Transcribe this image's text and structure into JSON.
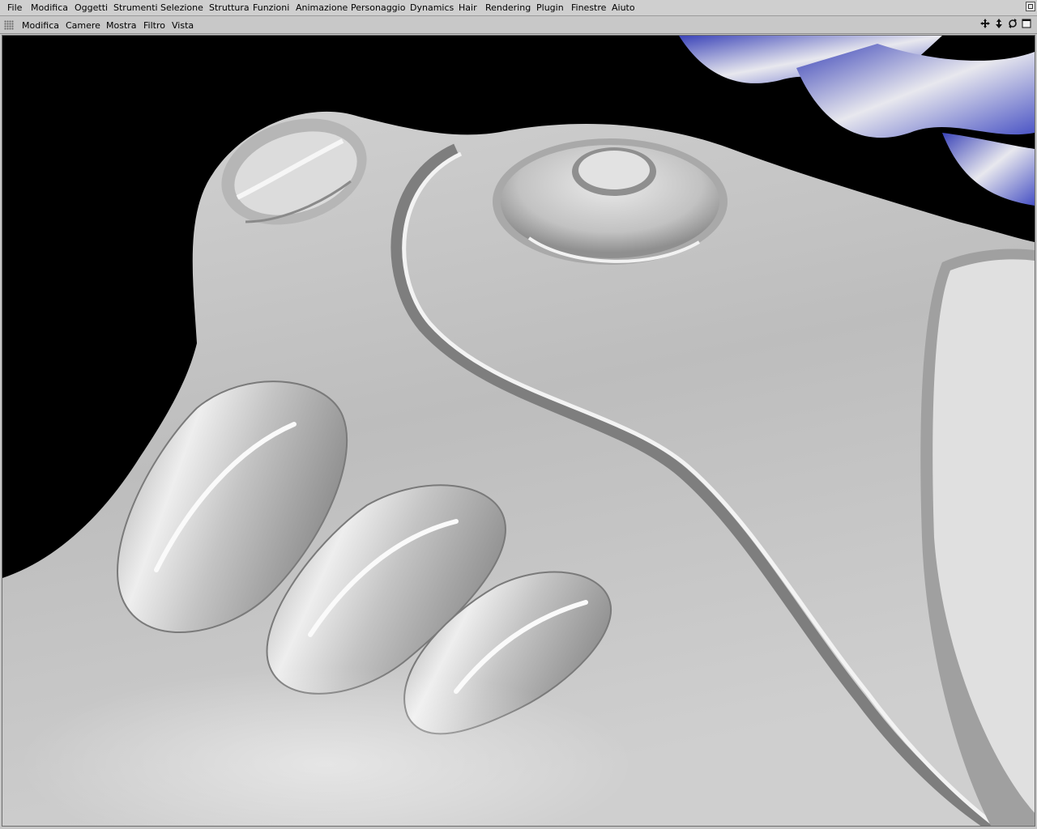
{
  "menubar": {
    "items": [
      "File",
      "Modifica",
      "Oggetti",
      "Strumenti",
      "Selezione",
      "Struttura",
      "Funzioni",
      "Animazione",
      "Personaggio",
      "Dynamics",
      "Hair",
      "Rendering",
      "Plugin",
      "Finestre",
      "Aiuto"
    ]
  },
  "viewport_menu": {
    "items": [
      "Modifica",
      "Camere",
      "Mostra",
      "Filtro",
      "Vista"
    ]
  },
  "nav_icons": [
    "move-view-icon",
    "dolly-view-icon",
    "rotate-view-icon",
    "maximize-view-icon"
  ],
  "colors": {
    "viewport_bg": "#000000",
    "mesh_light": "#e6e6e6",
    "mesh_mid": "#b5b5b5",
    "mesh_shadow": "#7c7c7c",
    "hair_blue": "#4a55c8"
  }
}
